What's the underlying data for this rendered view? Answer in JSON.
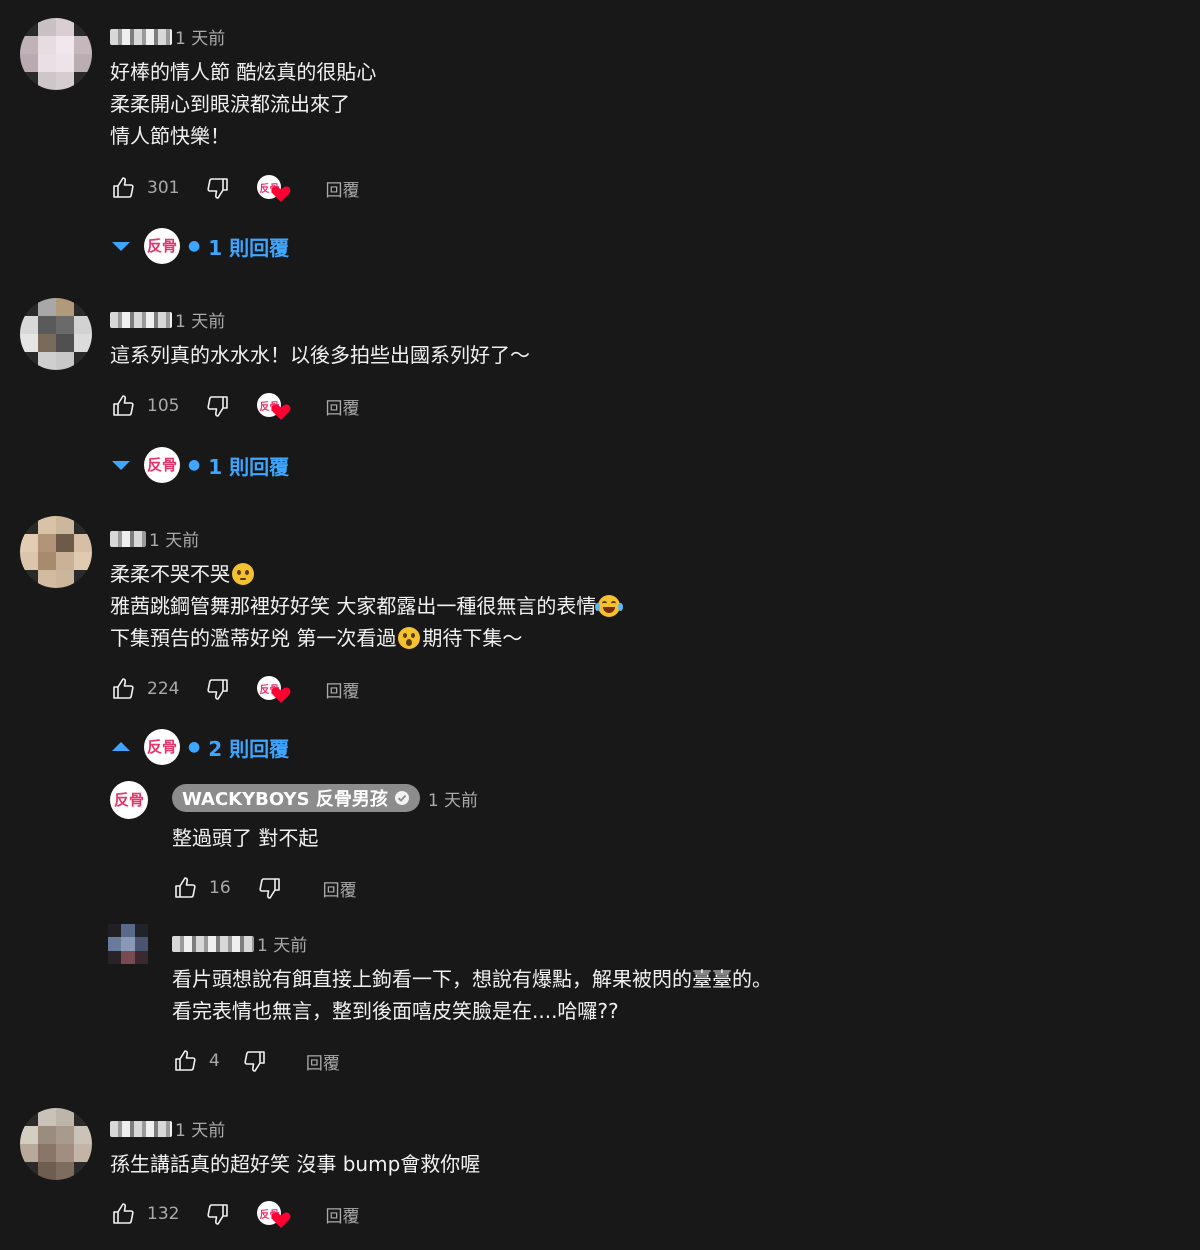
{
  "colors": {
    "background": "#181818",
    "link": "#3ea6ff",
    "heart": "#ff0033",
    "muted": "#aaaaaa"
  },
  "reply_label": "回覆",
  "comments": [
    {
      "time": "1 天前",
      "lines": [
        "好棒的情人節 酷炫真的很貼心",
        "柔柔開心到眼淚都流出來了",
        "情人節快樂！"
      ],
      "likes": "301",
      "replies_toggle": "1 則回覆"
    },
    {
      "time": "1 天前",
      "lines": [
        "這系列真的水水水！以後多拍些出國系列好了～"
      ],
      "likes": "105",
      "replies_toggle": "1 則回覆"
    },
    {
      "time": "1 天前",
      "line1": "柔柔不哭不哭",
      "line2": "雅茜跳鋼管舞那裡好好笑 大家都露出一種很無言的表情",
      "line3a": "下集預告的濫蒂好兇 第一次看過",
      "line3b": "期待下集～",
      "likes": "224",
      "replies_toggle": "2 則回覆",
      "replies": [
        {
          "author": "WACKYBOYS 反骨男孩",
          "time": "1 天前",
          "lines": [
            "整過頭了 對不起"
          ],
          "likes": "16"
        },
        {
          "time": "1 天前",
          "lines": [
            "看片頭想說有餌直接上鉤看一下，想說有爆點，解果被閃的臺臺的。",
            "看完表情也無言，整到後面嘻皮笑臉是在....哈囉??"
          ],
          "likes": "4"
        }
      ]
    },
    {
      "time": "1 天前",
      "lines": [
        "孫生講話真的超好笑 沒事 bump會救你喔"
      ],
      "likes": "132"
    }
  ],
  "channel_logo_text": "反骨"
}
